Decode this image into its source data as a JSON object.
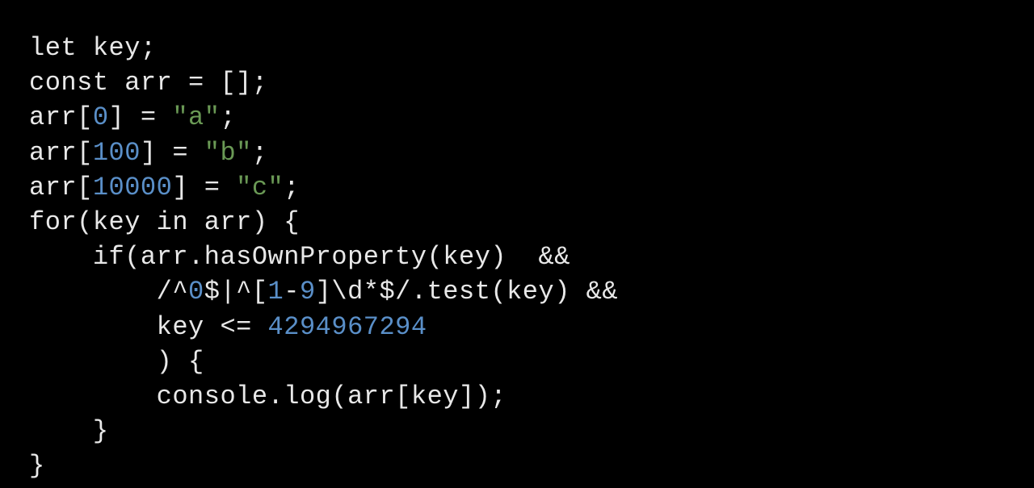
{
  "code": {
    "line1": {
      "t1": "let key;"
    },
    "line2": {
      "t1": "const arr = [];"
    },
    "line3": {
      "t1": "arr[",
      "n1": "0",
      "t2": "] = ",
      "s1": "\"a\"",
      "t3": ";"
    },
    "line4": {
      "t1": "arr[",
      "n1": "100",
      "t2": "] = ",
      "s1": "\"b\"",
      "t3": ";"
    },
    "line5": {
      "t1": "arr[",
      "n1": "10000",
      "t2": "] = ",
      "s1": "\"c\"",
      "t3": ";"
    },
    "line6": {
      "t1": "for(key in arr) {"
    },
    "line7": {
      "t1": "    if(arr.hasOwnProperty(key)  &&"
    },
    "line8": {
      "t1": "        /^",
      "n1": "0",
      "t2": "$|^[",
      "n2": "1",
      "t3": "-",
      "n3": "9",
      "t4": "]\\d*$/.test(key) &&"
    },
    "line9": {
      "t1": "        key <= ",
      "n1": "4294967294"
    },
    "line10": {
      "t1": "        ) {"
    },
    "line11": {
      "t1": "        console.log(arr[key]);"
    },
    "line12": {
      "t1": "    }"
    },
    "line13": {
      "t1": "}"
    }
  }
}
